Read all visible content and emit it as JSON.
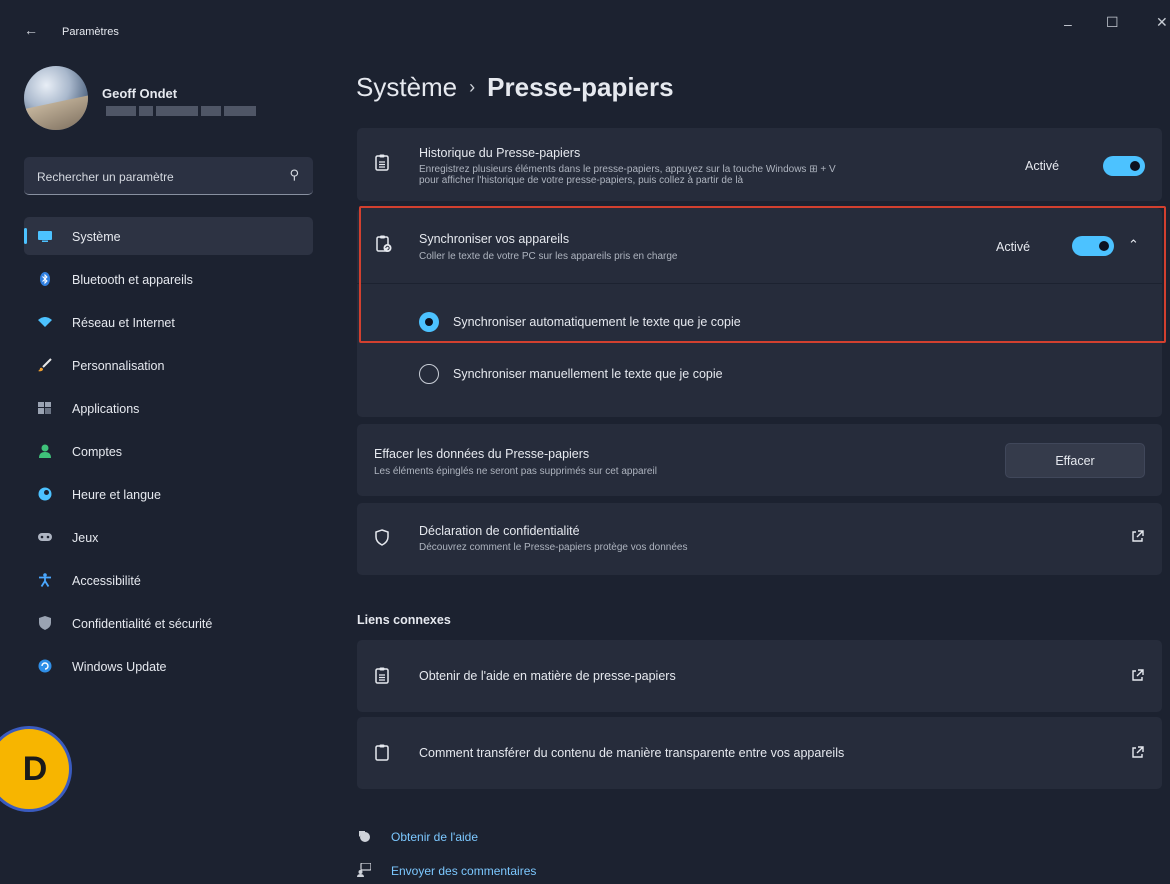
{
  "window": {
    "title": "Paramètres",
    "back_glyph": "←",
    "min_glyph": "–",
    "max_glyph": "☐",
    "close_glyph": "✕"
  },
  "profile": {
    "name": "Geoff Ondet"
  },
  "search": {
    "placeholder": "Rechercher un paramètre"
  },
  "nav": {
    "items": [
      {
        "label": "Système",
        "icon": "monitor-icon"
      },
      {
        "label": "Bluetooth et appareils",
        "icon": "bluetooth-icon"
      },
      {
        "label": "Réseau et Internet",
        "icon": "wifi-icon"
      },
      {
        "label": "Personnalisation",
        "icon": "brush-icon"
      },
      {
        "label": "Applications",
        "icon": "apps-icon"
      },
      {
        "label": "Comptes",
        "icon": "person-icon"
      },
      {
        "label": "Heure et langue",
        "icon": "globe-icon"
      },
      {
        "label": "Jeux",
        "icon": "gamepad-icon"
      },
      {
        "label": "Accessibilité",
        "icon": "accessibility-icon"
      },
      {
        "label": "Confidentialité et sécurité",
        "icon": "shield-icon"
      },
      {
        "label": "Windows Update",
        "icon": "update-icon"
      }
    ],
    "active_index": 0
  },
  "badge": {
    "letter": "D"
  },
  "header": {
    "crumb": "Système",
    "separator": "›",
    "current": "Presse-papiers"
  },
  "history": {
    "title": "Historique du Presse-papiers",
    "desc_line1": "Enregistrez plusieurs éléments dans le presse-papiers, appuyez sur la touche Windows ⊞ + V",
    "desc_line2": "pour afficher l'historique de votre presse-papiers, puis collez à partir de là",
    "state": "Activé",
    "toggle_on": true
  },
  "sync": {
    "title": "Synchroniser vos appareils",
    "desc": "Coller le texte de votre PC sur les appareils pris en charge",
    "state": "Activé",
    "toggle_on": true,
    "options": [
      {
        "label": "Synchroniser automatiquement le texte que je copie",
        "selected": true
      },
      {
        "label": "Synchroniser manuellement le texte que je copie",
        "selected": false
      }
    ]
  },
  "clear": {
    "title": "Effacer les données du Presse-papiers",
    "desc": "Les éléments épinglés ne seront pas supprimés sur cet appareil",
    "button": "Effacer"
  },
  "privacy": {
    "title": "Déclaration de confidentialité",
    "desc": "Découvrez comment le Presse-papiers protège vos données"
  },
  "related": {
    "heading": "Liens connexes",
    "items": [
      {
        "label": "Obtenir de l'aide en matière de presse-papiers"
      },
      {
        "label": "Comment transférer du contenu de manière transparente entre vos appareils"
      }
    ]
  },
  "footer": {
    "help": "Obtenir de l'aide",
    "feedback": "Envoyer des commentaires"
  },
  "colors": {
    "accent": "#4cc2ff",
    "highlight_border": "#d2402f",
    "background": "#1c2230",
    "card": "#262c3b"
  }
}
